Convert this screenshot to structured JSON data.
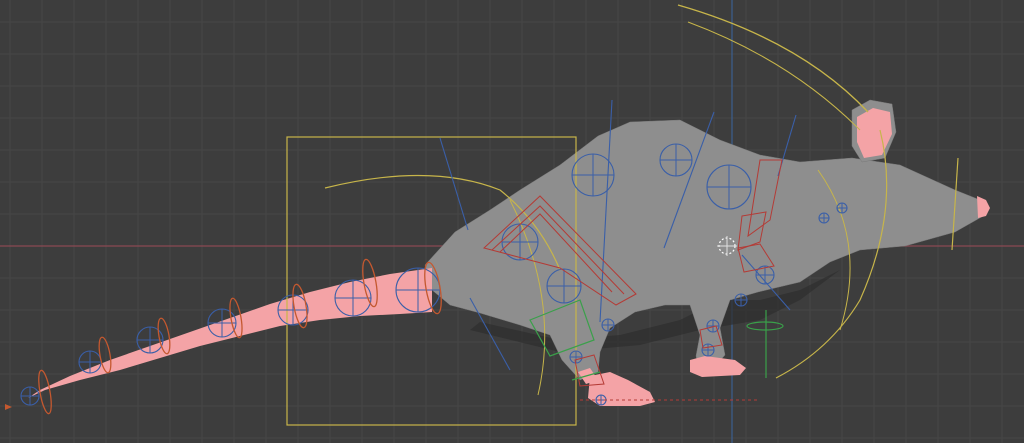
{
  "viewport": {
    "name": "3D Viewport",
    "background": "#3d3d3d",
    "grid_color": "#474747",
    "axis_x_color": "#8a4a52",
    "axis_y_color": "#3b5f8f"
  },
  "model": {
    "body_color": "#8e8e8e",
    "skin_color": "#f4a3a6",
    "shadow_color": "#2e2e2e"
  },
  "rig": {
    "control_yellow": "#c7b54a",
    "control_blue": "#3a5fa8",
    "control_orange": "#c4582f",
    "control_red": "#b43b36",
    "control_green": "#3aa04a"
  }
}
